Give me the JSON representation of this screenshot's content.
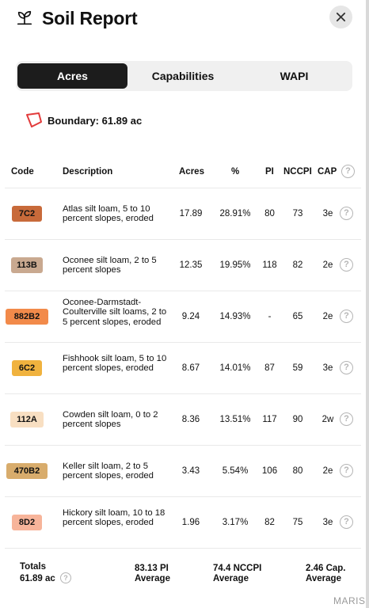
{
  "header": {
    "title": "Soil Report",
    "logo_icon": "sprout-icon",
    "close_icon": "close-icon"
  },
  "tabs": [
    {
      "label": "Acres",
      "active": true
    },
    {
      "label": "Capabilities",
      "active": false
    },
    {
      "label": "WAPI",
      "active": false
    }
  ],
  "boundary": {
    "label": "Boundary: 61.89 ac",
    "icon": "boundary-polygon-icon",
    "color": "#e23b3b"
  },
  "table": {
    "headers": {
      "code": "Code",
      "description": "Description",
      "acres": "Acres",
      "percent": "%",
      "pi": "PI",
      "nccpi": "NCCPI",
      "cap": "CAP"
    },
    "rows": [
      {
        "code": "7C2",
        "color": "#c86a3a",
        "description": "Atlas silt loam, 5 to 10 percent slopes, eroded",
        "acres": "17.89",
        "percent": "28.91%",
        "pi": "80",
        "nccpi": "73",
        "cap": "3e"
      },
      {
        "code": "113B",
        "color": "#c9a990",
        "description": "Oconee silt loam, 2 to 5 percent slopes",
        "acres": "12.35",
        "percent": "19.95%",
        "pi": "118",
        "nccpi": "82",
        "cap": "2e"
      },
      {
        "code": "882B2",
        "color": "#f28a4a",
        "description": "Oconee-Darmstadt-Coulterville silt loams, 2 to 5 percent slopes, eroded",
        "acres": "9.24",
        "percent": "14.93%",
        "pi": "-",
        "nccpi": "65",
        "cap": "2e"
      },
      {
        "code": "6C2",
        "color": "#f0b23e",
        "description": "Fishhook silt loam, 5 to 10 percent slopes, eroded",
        "acres": "8.67",
        "percent": "14.01%",
        "pi": "87",
        "nccpi": "59",
        "cap": "3e"
      },
      {
        "code": "112A",
        "color": "#f8dfc2",
        "description": "Cowden silt loam, 0 to 2 percent slopes",
        "acres": "8.36",
        "percent": "13.51%",
        "pi": "117",
        "nccpi": "90",
        "cap": "2w"
      },
      {
        "code": "470B2",
        "color": "#d8ac6c",
        "description": "Keller silt loam, 2 to 5 percent slopes, eroded",
        "acres": "3.43",
        "percent": "5.54%",
        "pi": "106",
        "nccpi": "80",
        "cap": "2e"
      },
      {
        "code": "8D2",
        "color": "#f7b49a",
        "description": "Hickory silt loam, 10 to 18 percent slopes, eroded",
        "acres": "1.96",
        "percent": "3.17%",
        "pi": "82",
        "nccpi": "75",
        "cap": "3e"
      }
    ]
  },
  "totals": {
    "label_line1": "Totals",
    "label_line2": "61.89 ac",
    "pi_line1": "83.13 PI",
    "pi_line2": "Average",
    "nccpi_line1": "74.4 NCCPI",
    "nccpi_line2": "Average",
    "cap_line1": "2.46 Cap.",
    "cap_line2": "Average"
  },
  "watermark": "MARIS"
}
